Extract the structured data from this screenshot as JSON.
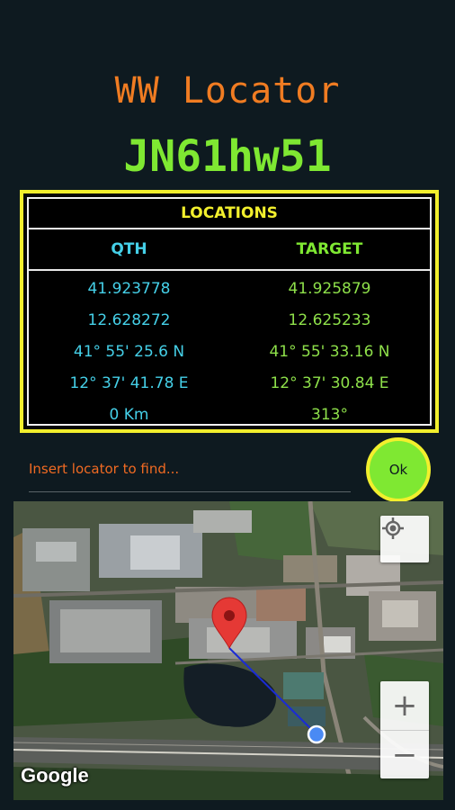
{
  "app": {
    "title": "WW Locator",
    "locator_code": "JN61hw51"
  },
  "locations": {
    "header": "LOCATIONS",
    "columns": {
      "qth": "QTH",
      "target": "TARGET"
    },
    "rows": [
      {
        "qth": "41.923778",
        "target": "41.925879"
      },
      {
        "qth": "12.628272",
        "target": "12.625233"
      },
      {
        "qth": "41° 55' 25.6 N",
        "target": "41° 55' 33.16 N"
      },
      {
        "qth": "12° 37' 41.78 E",
        "target": "12° 37' 30.84 E"
      },
      {
        "qth": "0 Km",
        "target": "313°"
      }
    ]
  },
  "search": {
    "placeholder": "Insert locator to find...",
    "value": "",
    "ok_label": "Ok"
  },
  "map": {
    "attribution": "Google",
    "zoom_in_label": "+",
    "zoom_out_label": "−",
    "my_location_icon": "crosshair-icon",
    "marker_icon": "map-pin-icon",
    "colors": {
      "marker": "#e53935",
      "route": "#1a2bd6",
      "dot": "#4a8af4"
    }
  },
  "colors": {
    "background": "#0e1a20",
    "title": "#f07c22",
    "locator": "#7fe832",
    "panel_border": "#f2ef2d",
    "qth": "#45d0e8",
    "target": "#8ee04a"
  }
}
